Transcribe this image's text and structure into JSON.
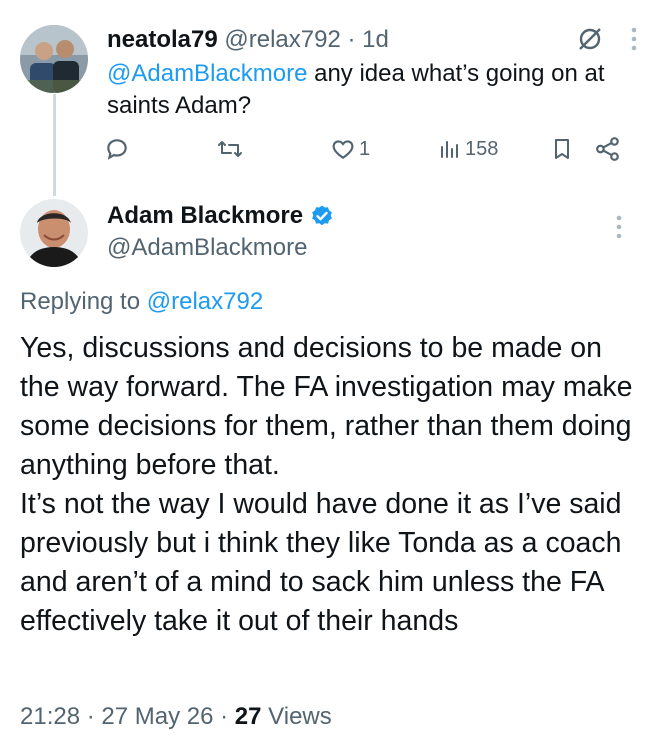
{
  "parent_tweet": {
    "display_name": "neatola79",
    "handle": "@relax792",
    "separator": " · ",
    "time_ago": "1d",
    "mention": "@AdamBlackmore",
    "text": " any idea what’s going on at saints Adam?",
    "actions": {
      "replies": "",
      "retweets": "",
      "likes": "1",
      "views": "158"
    }
  },
  "reply_tweet": {
    "display_name": "Adam Blackmore",
    "handle": "@AdamBlackmore",
    "replying_prefix": "Replying to ",
    "replying_to": "@relax792",
    "text": "Yes, discussions and decisions to be made on the way forward. The FA investigation may make some decisions for them, rather than them doing anything before that.\nIt’s not the way I would have done it as I’ve said previously but i think they like Tonda as a coach and aren’t of a mind to sack him unless the FA effectively take it out of their hands",
    "time": "21:28",
    "sep1": " · ",
    "date": "27 May 26",
    "sep2": " · ",
    "views_count": "27",
    "views_label": " Views"
  },
  "colors": {
    "accent": "#1d9bf0",
    "muted": "#536471",
    "text": "#0f1419",
    "line": "#cfd9de"
  },
  "icons": [
    "grok-icon",
    "more-icon",
    "reply-icon",
    "retweet-icon",
    "like-icon",
    "views-icon",
    "bookmark-icon",
    "share-icon",
    "verified-badge-icon"
  ]
}
